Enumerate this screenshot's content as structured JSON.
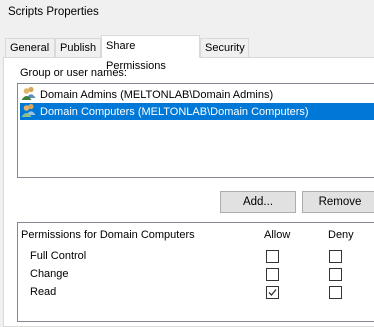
{
  "window": {
    "title": "Scripts Properties"
  },
  "tabs": [
    {
      "label": "General",
      "active": false
    },
    {
      "label": "Publish",
      "active": false
    },
    {
      "label": "Share Permissions",
      "active": true
    },
    {
      "label": "Security",
      "active": false
    }
  ],
  "group_section": {
    "label": "Group or user names:",
    "items": [
      {
        "label": "Domain Admins (MELTONLAB\\Domain Admins)",
        "icon": "users-icon",
        "selected": false
      },
      {
        "label": "Domain Computers (MELTONLAB\\Domain Computers)",
        "icon": "users-icon",
        "selected": true
      }
    ],
    "add_label": "Add...",
    "remove_label": "Remove"
  },
  "permissions": {
    "header": "Permissions for Domain Computers",
    "allow_header": "Allow",
    "deny_header": "Deny",
    "rows": [
      {
        "label": "Full Control",
        "allow": false,
        "deny": false
      },
      {
        "label": "Change",
        "allow": false,
        "deny": false
      },
      {
        "label": "Read",
        "allow": true,
        "deny": false
      }
    ]
  },
  "colors": {
    "selection": "#0078d7",
    "background": "#f0f0f0"
  }
}
